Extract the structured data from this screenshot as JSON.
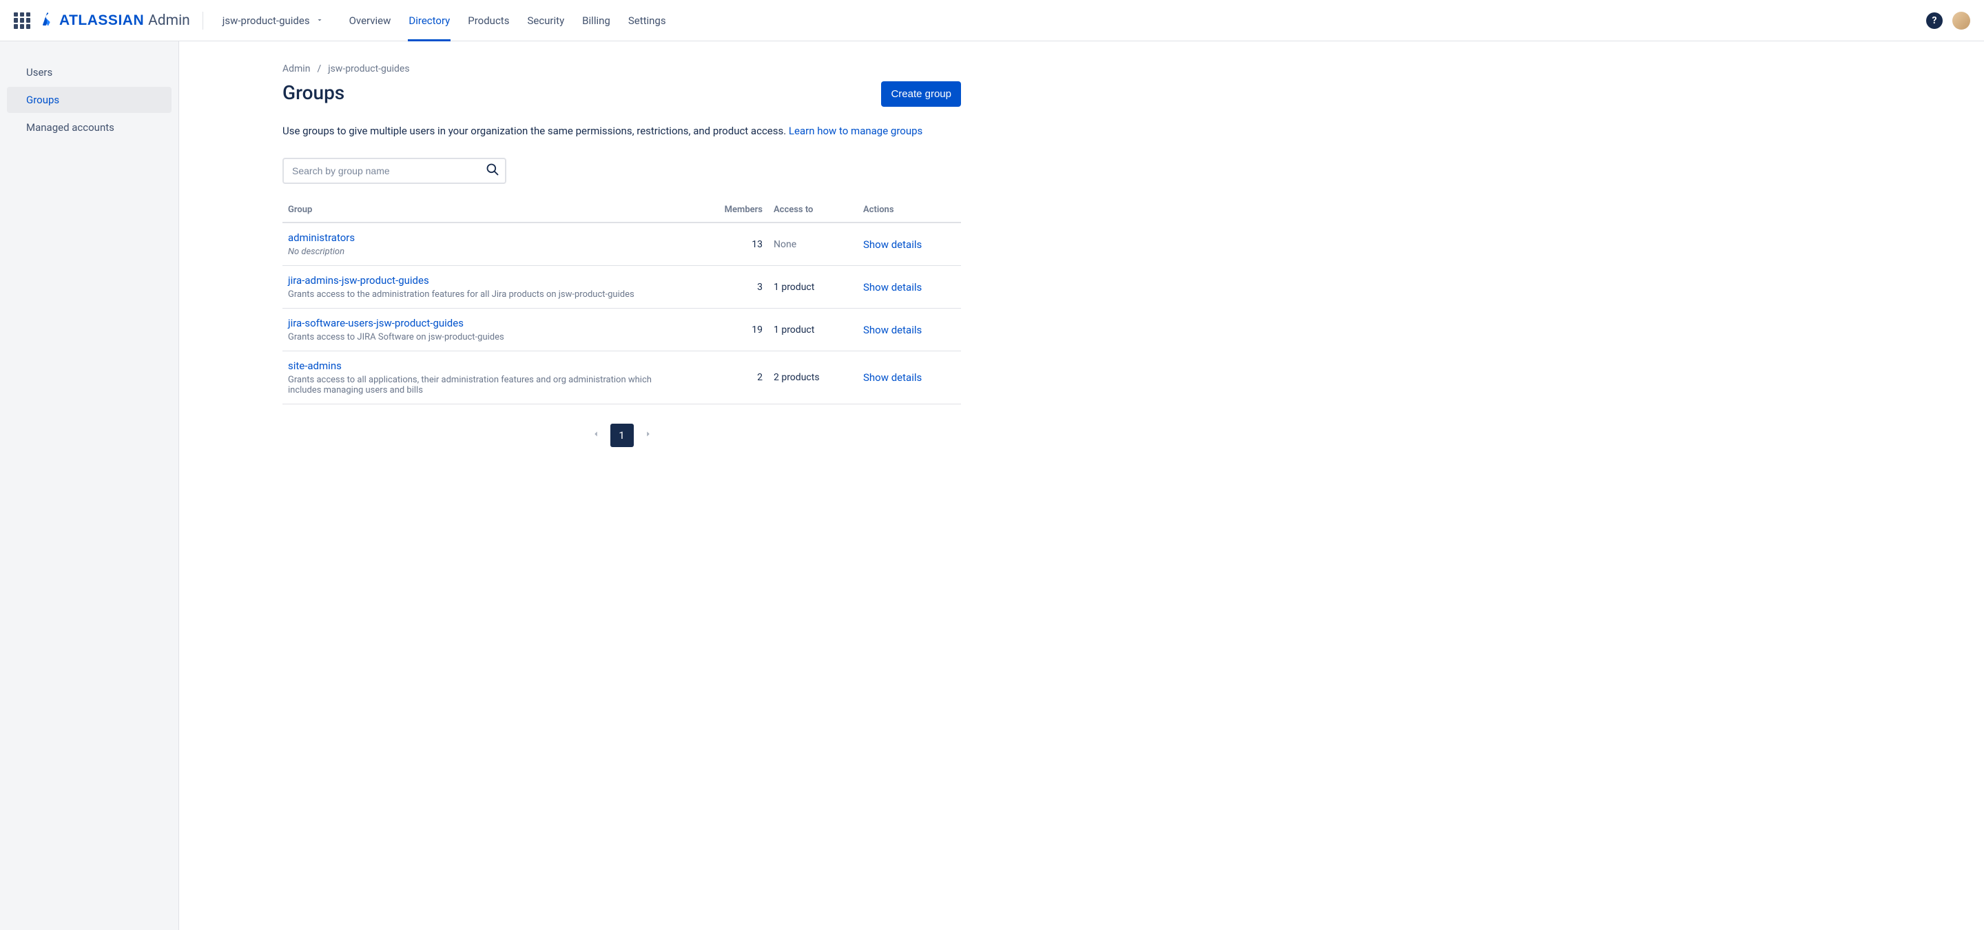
{
  "brand": {
    "name": "ATLASSIAN",
    "suffix": "Admin"
  },
  "site_switcher": {
    "label": "jsw-product-guides"
  },
  "nav": {
    "tabs": [
      {
        "label": "Overview",
        "active": false
      },
      {
        "label": "Directory",
        "active": true
      },
      {
        "label": "Products",
        "active": false
      },
      {
        "label": "Security",
        "active": false
      },
      {
        "label": "Billing",
        "active": false
      },
      {
        "label": "Settings",
        "active": false
      }
    ]
  },
  "sidebar": {
    "items": [
      {
        "label": "Users",
        "active": false
      },
      {
        "label": "Groups",
        "active": true
      },
      {
        "label": "Managed accounts",
        "active": false
      }
    ]
  },
  "breadcrumb": {
    "items": [
      "Admin",
      "jsw-product-guides"
    ]
  },
  "page": {
    "title": "Groups",
    "create_button": "Create group",
    "description": "Use groups to give multiple users in your organization the same permissions, restrictions, and product access. ",
    "learn_link": "Learn how to manage groups",
    "search_placeholder": "Search by group name"
  },
  "table": {
    "headers": {
      "group": "Group",
      "members": "Members",
      "access": "Access to",
      "actions": "Actions"
    },
    "show_details": "Show details",
    "no_description": "No description",
    "rows": [
      {
        "name": "administrators",
        "desc": "",
        "members": "13",
        "access": "None",
        "access_muted": true
      },
      {
        "name": "jira-admins-jsw-product-guides",
        "desc": "Grants access to the administration features for all Jira products on jsw-product-guides",
        "members": "3",
        "access": "1 product",
        "access_muted": false
      },
      {
        "name": "jira-software-users-jsw-product-guides",
        "desc": "Grants access to JIRA Software on jsw-product-guides",
        "members": "19",
        "access": "1 product",
        "access_muted": false
      },
      {
        "name": "site-admins",
        "desc": "Grants access to all applications, their administration features and org administration which includes managing users and bills",
        "members": "2",
        "access": "2 products",
        "access_muted": false
      }
    ]
  },
  "pagination": {
    "current": "1"
  }
}
